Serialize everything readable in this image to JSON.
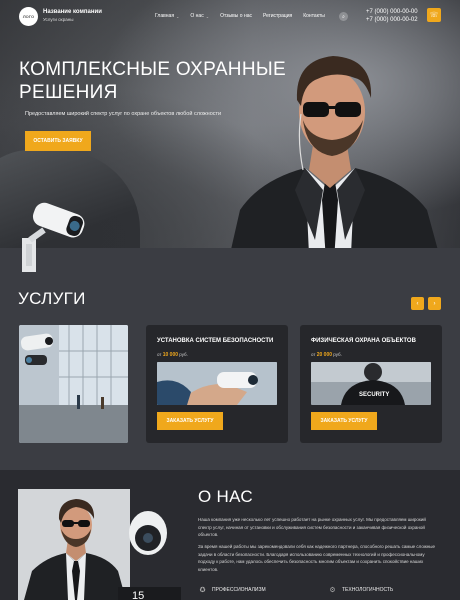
{
  "header": {
    "logo_text": "ЛОГО",
    "company_name": "Название компании",
    "company_slogan": "Услуги охраны",
    "nav": [
      {
        "label": "Главная",
        "has_dropdown": true
      },
      {
        "label": "О нас",
        "has_dropdown": true
      },
      {
        "label": "Отзывы о нас",
        "has_dropdown": false
      },
      {
        "label": "Регистрация",
        "has_dropdown": false
      },
      {
        "label": "Контакты",
        "has_dropdown": false
      }
    ],
    "search_icon": "search-icon",
    "phone_1": "+7 (000) 000-00-00",
    "phone_2": "+7 (000) 000-00-02",
    "call_icon": "phone-icon"
  },
  "hero": {
    "title_line1": "Комплексные охранные",
    "title_line2": "решения",
    "subtitle": "Предоставляем широкий спектр услуг по охране объектов любой сложности",
    "button_label": "Оставить заявку"
  },
  "services": {
    "title": "Услуги",
    "cards": [
      {
        "title": "Установка систем безопасности",
        "price_prefix": "от",
        "price": "10 000",
        "price_unit": "руб.",
        "button_label": "Заказать услугу"
      },
      {
        "title": "Физическая охрана объектов",
        "price_prefix": "от",
        "price": "20 000",
        "price_unit": "руб.",
        "button_label": "Заказать услугу"
      }
    ],
    "security_badge": "SECURITY"
  },
  "about": {
    "title": "О нас",
    "paragraph_1": "Наша компания уже несколько лет успешно работает на рынке охранных услуг. Мы предоставляем широкий спектр услуг, начиная от установки и обслуживания систем безопасности и заканчивая физической охраной объектов.",
    "paragraph_2": "За время нашей работы мы зарекомендовали себя как надежного партнера, способного решать самые сложные задачи в области безопасности. Благодаря использованию современных технологий и профессиональному подходу к работе, нам удалось обеспечить безопасность многим объектам и сохранить спокойствие наших клиентов.",
    "stat_value": "15",
    "features": [
      {
        "label": "Профессионализм",
        "icon": "medal-icon"
      },
      {
        "label": "Технологичность",
        "icon": "chip-icon"
      }
    ]
  },
  "colors": {
    "accent": "#f0a81c",
    "dark_bg": "#3b3d43",
    "card_bg": "#26272b"
  }
}
